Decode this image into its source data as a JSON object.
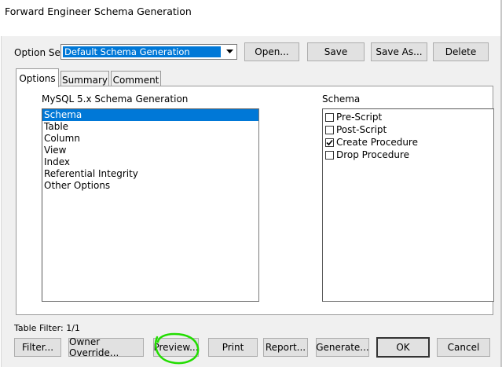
{
  "window": {
    "title": "Forward Engineer Schema Generation"
  },
  "option_set": {
    "label": "Option Set:",
    "value": "Default Schema Generation",
    "open_label": "Open...",
    "save_label": "Save",
    "save_as_label": "Save As...",
    "delete_label": "Delete"
  },
  "tabs": [
    {
      "label": "Options",
      "active": true
    },
    {
      "label": "Summary",
      "active": false
    },
    {
      "label": "Comment",
      "active": false
    }
  ],
  "options_list": {
    "header": "MySQL 5.x Schema Generation",
    "items": [
      "Schema",
      "Table",
      "Column",
      "View",
      "Index",
      "Referential Integrity",
      "Other Options"
    ],
    "selected": "Schema"
  },
  "schema": {
    "header": "Schema",
    "items": [
      {
        "label": "Pre-Script",
        "checked": false
      },
      {
        "label": "Post-Script",
        "checked": false
      },
      {
        "label": "Create Procedure",
        "checked": true
      },
      {
        "label": "Drop Procedure",
        "checked": false
      }
    ]
  },
  "status": {
    "table_filter": "Table Filter: 1/1"
  },
  "buttons": {
    "filter": "Filter...",
    "owner_override": "Owner Override...",
    "preview": "Preview...",
    "print": "Print",
    "report": "Report...",
    "generate": "Generate...",
    "ok": "OK",
    "cancel": "Cancel"
  },
  "colors": {
    "selection": "#0078d7",
    "annotation": "#22dd00",
    "dialog_bg": "#f0f0f0"
  }
}
